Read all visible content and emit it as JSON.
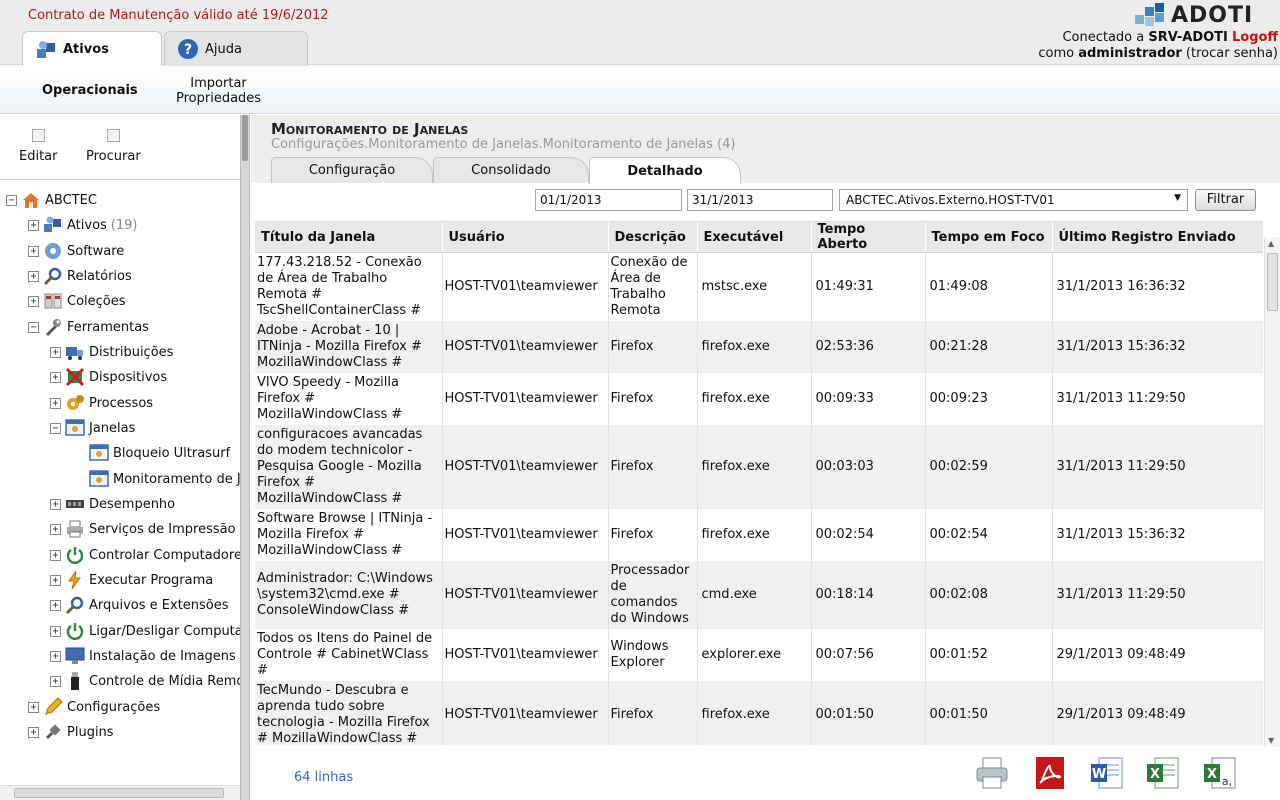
{
  "header": {
    "contract_notice": "Contrato de Manutenção válido até 19/6/2012",
    "logo_text": "ADOTI",
    "connected_prefix": "Conectado a ",
    "server": "SRV-ADOTI",
    "logoff": "Logoff",
    "as_prefix": "como ",
    "user": "administrador",
    "change_password": " (trocar senha)"
  },
  "top_tabs": [
    {
      "label": "Ativos",
      "icon": "assets-icon",
      "active": true
    },
    {
      "label": "Ajuda",
      "icon": "help-icon",
      "active": false
    }
  ],
  "subnav": {
    "operacionais": "Operacionais",
    "importar_line1": "Importar",
    "importar_line2": "Propriedades"
  },
  "sidebar": {
    "tools": [
      {
        "label": "Editar"
      },
      {
        "label": "Procurar"
      }
    ],
    "tree": {
      "root": "ABCTEC",
      "ativos": "Ativos",
      "ativos_count": "(19)",
      "software": "Software",
      "relatorios": "Relatórios",
      "colecoes": "Coleções",
      "ferramentas": "Ferramentas",
      "distribuicoes": "Distribuições",
      "dispositivos": "Dispositivos",
      "processos": "Processos",
      "janelas": "Janelas",
      "bloqueio": "Bloqueio Ultrasurf",
      "monitoramento": "Monitoramento de Janelas",
      "desempenho": "Desempenho",
      "servicos": "Serviços de Impressão",
      "controlar": "Controlar Computadores",
      "executar": "Executar Programa",
      "arquivos": "Arquivos e Extensões",
      "ligar": "Ligar/Desligar Computadores",
      "instalacao": "Instalação de Imagens",
      "controle_midia": "Controle de Mídia Removível",
      "configuracoes": "Configurações",
      "plugins": "Plugins"
    }
  },
  "main": {
    "title": "Monitoramento de Janelas",
    "breadcrumb": "Configurações.Monitoramento de Janelas.Monitoramento de Janelas (4)",
    "view_tabs": [
      {
        "label": "Configuração",
        "active": false
      },
      {
        "label": "Consolidado",
        "active": false
      },
      {
        "label": "Detalhado",
        "active": true
      }
    ],
    "filter": {
      "date_from": "01/1/2013",
      "date_to": "31/1/2013",
      "host": "ABCTEC.Ativos.Externo.HOST-TV01",
      "button": "Filtrar"
    },
    "columns": [
      "Título da Janela",
      "Usuário",
      "Descrição",
      "Executável",
      "Tempo Aberto",
      "Tempo em Foco",
      "Último Registro Enviado"
    ],
    "rows": [
      {
        "title": "177.43.218.52 - Conexão de Área de Trabalho Remota # TscShellContainerClass #",
        "user": "HOST-TV01\\teamviewer",
        "desc": "Conexão de Área de Trabalho Remota",
        "exe": "mstsc.exe",
        "open": "01:49:31",
        "focus": "01:49:08",
        "last": "31/1/2013 16:36:32"
      },
      {
        "title": "Adobe - Acrobat - 10 | ITNinja - Mozilla Firefox # MozillaWindowClass #",
        "user": "HOST-TV01\\teamviewer",
        "desc": "Firefox",
        "exe": "firefox.exe",
        "open": "02:53:36",
        "focus": "00:21:28",
        "last": "31/1/2013 15:36:32"
      },
      {
        "title": "VIVO Speedy - Mozilla Firefox # MozillaWindowClass #",
        "user": "HOST-TV01\\teamviewer",
        "desc": "Firefox",
        "exe": "firefox.exe",
        "open": "00:09:33",
        "focus": "00:09:23",
        "last": "31/1/2013 11:29:50"
      },
      {
        "title": "configuracoes avancadas do modem technicolor - Pesquisa Google - Mozilla Firefox # MozillaWindowClass #",
        "user": "HOST-TV01\\teamviewer",
        "desc": "Firefox",
        "exe": "firefox.exe",
        "open": "00:03:03",
        "focus": "00:02:59",
        "last": "31/1/2013 11:29:50"
      },
      {
        "title": "Software Browse | ITNinja - Mozilla Firefox # MozillaWindowClass #",
        "user": "HOST-TV01\\teamviewer",
        "desc": "Firefox",
        "exe": "firefox.exe",
        "open": "00:02:54",
        "focus": "00:02:54",
        "last": "31/1/2013 15:36:32"
      },
      {
        "title": "Administrador: C:\\Windows \\system32\\cmd.exe # ConsoleWindowClass #",
        "user": "HOST-TV01\\teamviewer",
        "desc": "Processador de comandos do Windows",
        "exe": "cmd.exe",
        "open": "00:18:14",
        "focus": "00:02:08",
        "last": "31/1/2013 11:29:50"
      },
      {
        "title": "Todos os Itens do Painel de Controle # CabinetWClass #",
        "user": "HOST-TV01\\teamviewer",
        "desc": "Windows Explorer",
        "exe": "explorer.exe",
        "open": "00:07:56",
        "focus": "00:01:52",
        "last": "29/1/2013 09:48:49"
      },
      {
        "title": "TecMundo - Descubra e aprenda tudo sobre tecnologia - Mozilla Firefox # MozillaWindowClass #",
        "user": "HOST-TV01\\teamviewer",
        "desc": "Firefox",
        "exe": "firefox.exe",
        "open": "00:01:50",
        "focus": "00:01:50",
        "last": "29/1/2013 09:48:49"
      }
    ],
    "row_count": "64 linhas",
    "exports": [
      "print-icon",
      "pdf-icon",
      "word-icon",
      "excel-icon",
      "csv-icon"
    ]
  }
}
